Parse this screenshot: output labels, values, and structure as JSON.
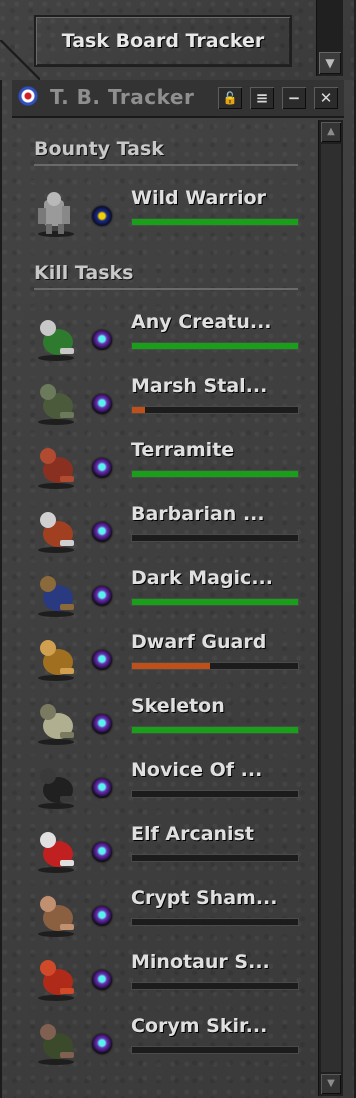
{
  "top_panel": {
    "button_label": "Task Board Tracker",
    "scroll_down_glyph": "▼"
  },
  "window": {
    "title": "T. B. Tracker",
    "logo_icon": "target-logo-icon",
    "buttons": {
      "lock": "🔓",
      "menu": "≡",
      "minimize": "−",
      "close": "✕"
    },
    "scroll_up_glyph": "▲",
    "scroll_down_glyph": "▼"
  },
  "bounty": {
    "header": "Bounty Task",
    "task": {
      "name": "Wild Warrior",
      "icon": "wild-warrior-sprite",
      "orb": "star-orb-icon",
      "progress": 1.0,
      "color": "#19a019"
    }
  },
  "kill": {
    "header": "Kill Tasks",
    "tasks": [
      {
        "name": "Any Creatu...",
        "icon": "any-creature-sprite",
        "progress": 1.0,
        "color": "#19a019"
      },
      {
        "name": "Marsh Stal...",
        "icon": "marsh-stalker-sprite",
        "progress": 0.08,
        "color": "#c0501a"
      },
      {
        "name": "Terramite",
        "icon": "terramite-sprite",
        "progress": 1.0,
        "color": "#19a019"
      },
      {
        "name": "Barbarian ...",
        "icon": "barbarian-sprite",
        "progress": 0.0,
        "color": "#19a019"
      },
      {
        "name": "Dark Magic...",
        "icon": "dark-magician-sprite",
        "progress": 1.0,
        "color": "#19a019"
      },
      {
        "name": "Dwarf Guard",
        "icon": "dwarf-guard-sprite",
        "progress": 0.47,
        "color": "#c0501a"
      },
      {
        "name": "Skeleton",
        "icon": "skeleton-sprite",
        "progress": 1.0,
        "color": "#19a019"
      },
      {
        "name": "Novice Of ...",
        "icon": "novice-sprite",
        "progress": 0.0,
        "color": "#19a019"
      },
      {
        "name": "Elf Arcanist",
        "icon": "elf-arcanist-sprite",
        "progress": 0.0,
        "color": "#19a019"
      },
      {
        "name": "Crypt Sham...",
        "icon": "crypt-shambler-sprite",
        "progress": 0.0,
        "color": "#19a019"
      },
      {
        "name": "Minotaur S...",
        "icon": "minotaur-sprite",
        "progress": 0.0,
        "color": "#19a019"
      },
      {
        "name": "Corym Skir...",
        "icon": "corym-skirmisher-sprite",
        "progress": 0.0,
        "color": "#19a019"
      }
    ]
  }
}
